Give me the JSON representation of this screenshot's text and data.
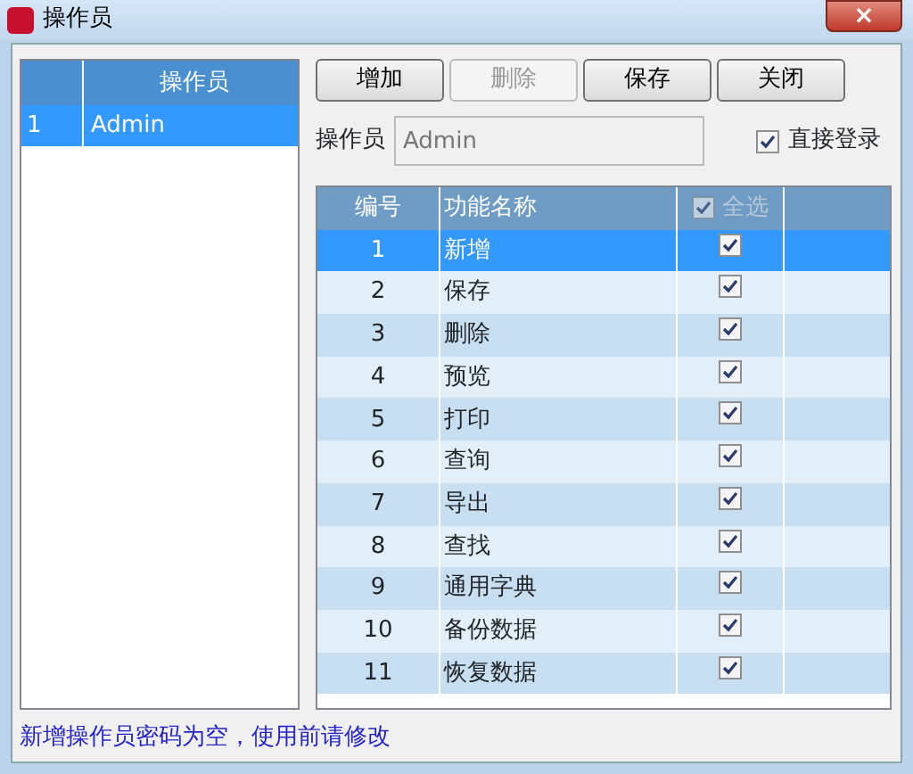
{
  "window": {
    "title": "操作员",
    "close": "×"
  },
  "operator_list": {
    "columns": [
      "",
      "操作员"
    ],
    "rows": [
      {
        "cells": [
          "1",
          "Admin"
        ],
        "selected": true
      }
    ]
  },
  "buttons": [
    {
      "label": "增加",
      "disabled": false
    },
    {
      "label": "删除",
      "disabled": true
    },
    {
      "label": "保存",
      "disabled": false
    },
    {
      "label": "关闭",
      "disabled": false
    }
  ],
  "operator_field": {
    "label": "操作员",
    "value": "Admin"
  },
  "direct_login": {
    "label": "直接登录",
    "checked": true
  },
  "permissions": {
    "columns": [
      "编号",
      "功能名称"
    ],
    "select_all": {
      "label": "全选",
      "checked": true
    },
    "rows": [
      {
        "number": "1",
        "name": "新增",
        "checked": true,
        "selected": true
      },
      {
        "number": "2",
        "name": "保存",
        "checked": true,
        "selected": false
      },
      {
        "number": "3",
        "name": "删除",
        "checked": true,
        "selected": false
      },
      {
        "number": "4",
        "name": "预览",
        "checked": true,
        "selected": false
      },
      {
        "number": "5",
        "name": "打印",
        "checked": true,
        "selected": false
      },
      {
        "number": "6",
        "name": "查询",
        "checked": true,
        "selected": false
      },
      {
        "number": "7",
        "name": "导出",
        "checked": true,
        "selected": false
      },
      {
        "number": "8",
        "name": "查找",
        "checked": true,
        "selected": false
      },
      {
        "number": "9",
        "name": "通用字典",
        "checked": true,
        "selected": false
      },
      {
        "number": "10",
        "name": "备份数据",
        "checked": true,
        "selected": false
      },
      {
        "number": "11",
        "name": "恢复数据",
        "checked": true,
        "selected": false
      }
    ]
  },
  "status_bar": "新增操作员密码为空，使用前请修改"
}
